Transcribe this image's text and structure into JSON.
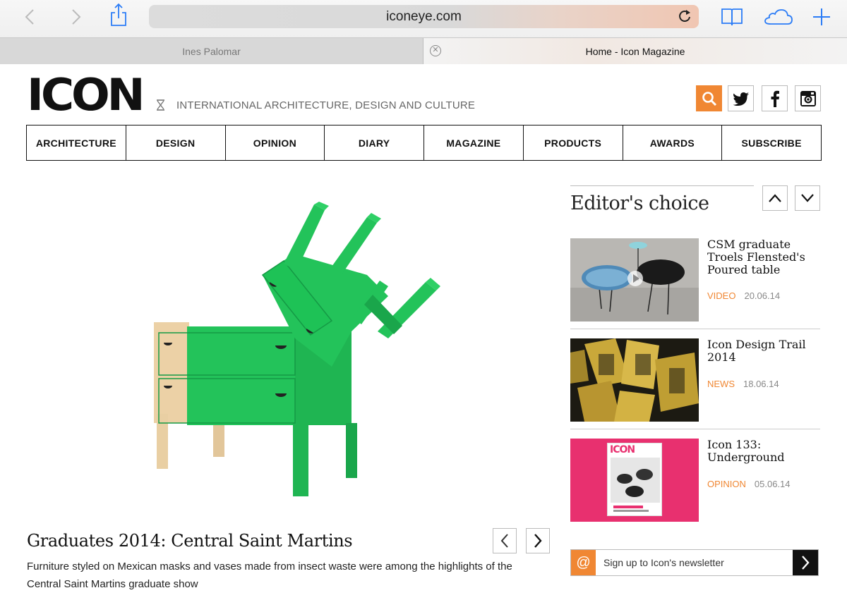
{
  "browser": {
    "url": "iconeye.com",
    "tabs": [
      {
        "label": "Ines Palomar",
        "active": false
      },
      {
        "label": "Home - Icon Magazine",
        "active": true
      }
    ]
  },
  "site": {
    "logo": "ICON",
    "tagline": "INTERNATIONAL ARCHITECTURE, DESIGN AND CULTURE",
    "accent": "#f08733"
  },
  "nav": [
    "ARCHITECTURE",
    "DESIGN",
    "OPINION",
    "DIARY",
    "MAGAZINE",
    "PRODUCTS",
    "AWARDS",
    "SUBSCRIBE"
  ],
  "hero": {
    "title": "Graduates 2014: Central Saint Martins",
    "description": "Furniture styled on Mexican masks and vases made from insect waste were among the highlights of the Central Saint Martins graduate show"
  },
  "editors_choice": {
    "title": "Editor's choice",
    "items": [
      {
        "headline": "CSM graduate Troels Flensted's Poured table",
        "category": "VIDEO",
        "date": "20.06.14"
      },
      {
        "headline": "Icon Design Trail 2014",
        "category": "NEWS",
        "date": "18.06.14"
      },
      {
        "headline": "Icon 133: Underground",
        "category": "OPINION",
        "date": "05.06.14"
      }
    ],
    "mag_cover_logo": "ICON"
  },
  "newsletter": {
    "placeholder": "Sign up to Icon's newsletter"
  }
}
